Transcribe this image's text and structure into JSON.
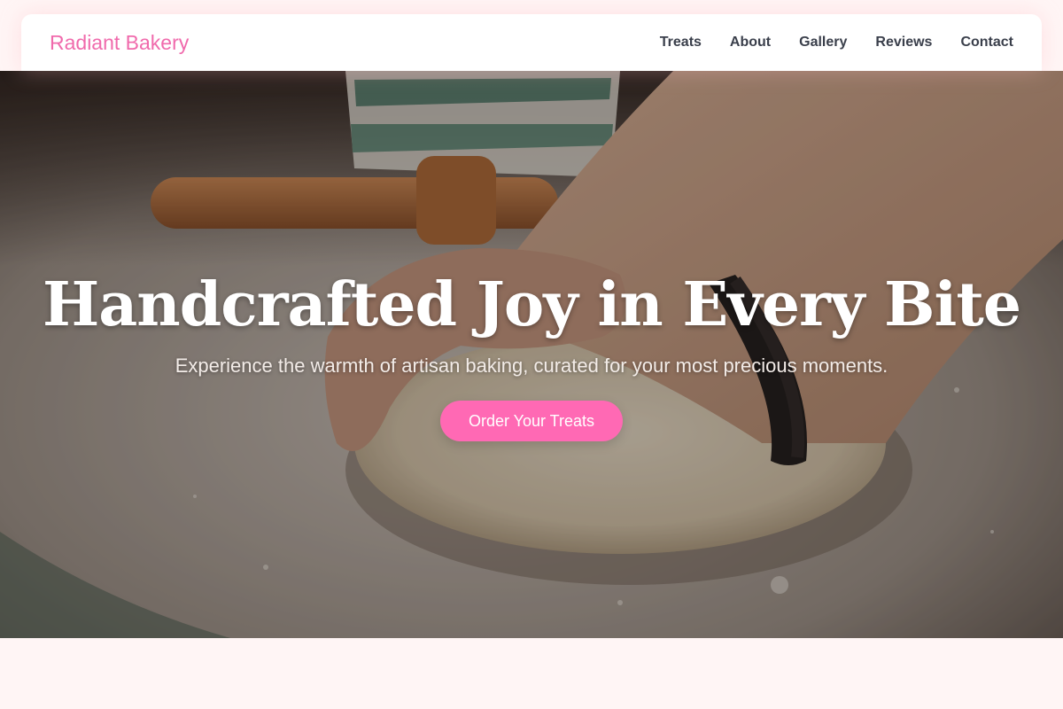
{
  "brand": {
    "name": "Radiant Bakery",
    "color": "#f06aac"
  },
  "nav": {
    "items": [
      {
        "label": "Treats"
      },
      {
        "label": "About"
      },
      {
        "label": "Gallery"
      },
      {
        "label": "Reviews"
      },
      {
        "label": "Contact"
      }
    ]
  },
  "hero": {
    "title": "Handcrafted Joy in Every Bite",
    "subtitle": "Experience the warmth of artisan baking, curated for your most precious moments.",
    "cta_label": "Order Your Treats",
    "cta_color": "#ff69b4",
    "image": "hands-kneading-dough-photo"
  },
  "colors": {
    "page_background": "#fff5f5",
    "nav_text": "#3a3f4b"
  }
}
